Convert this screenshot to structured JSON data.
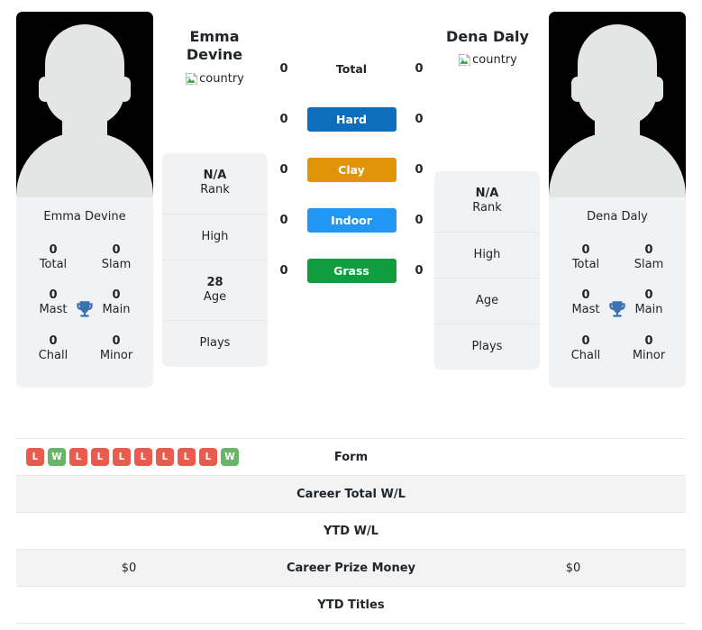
{
  "players": {
    "left": {
      "name": "Emma Devine",
      "photo_caption": "Emma Devine",
      "country_alt": "country",
      "stats": [
        {
          "value": "0",
          "label": "Total"
        },
        {
          "value": "0",
          "label": "Slam"
        },
        {
          "value": "0",
          "label": "Mast"
        },
        {
          "value": "0",
          "label": "Main"
        },
        {
          "value": "0",
          "label": "Chall"
        },
        {
          "value": "0",
          "label": "Minor"
        }
      ],
      "info": [
        {
          "value": "N/A",
          "label": "Rank"
        },
        {
          "value": "",
          "label": "High"
        },
        {
          "value": "28",
          "label": "Age"
        },
        {
          "value": "",
          "label": "Plays"
        }
      ]
    },
    "right": {
      "name": "Dena Daly",
      "photo_caption": "Dena Daly",
      "country_alt": "country",
      "stats": [
        {
          "value": "0",
          "label": "Total"
        },
        {
          "value": "0",
          "label": "Slam"
        },
        {
          "value": "0",
          "label": "Mast"
        },
        {
          "value": "0",
          "label": "Main"
        },
        {
          "value": "0",
          "label": "Chall"
        },
        {
          "value": "0",
          "label": "Minor"
        }
      ],
      "info": [
        {
          "value": "N/A",
          "label": "Rank"
        },
        {
          "value": "",
          "label": "High"
        },
        {
          "value": "",
          "label": "Age"
        },
        {
          "value": "",
          "label": "Plays"
        }
      ]
    }
  },
  "surfaces": [
    {
      "label": "Total",
      "left": "0",
      "right": "0",
      "color": "transparent",
      "plain": true
    },
    {
      "label": "Hard",
      "left": "0",
      "right": "0",
      "color": "#0d6ebd",
      "plain": false
    },
    {
      "label": "Clay",
      "left": "0",
      "right": "0",
      "color": "#e19407",
      "plain": false
    },
    {
      "label": "Indoor",
      "left": "0",
      "right": "0",
      "color": "#2196f3",
      "plain": false
    },
    {
      "label": "Grass",
      "left": "0",
      "right": "0",
      "color": "#0f9d3f",
      "plain": false
    }
  ],
  "table": [
    {
      "label": "Form",
      "type": "form",
      "striped": false,
      "left_form": [
        "L",
        "W",
        "L",
        "L",
        "L",
        "L",
        "L",
        "L",
        "L",
        "W"
      ],
      "right_form": [],
      "left": "",
      "right": ""
    },
    {
      "label": "Career Total W/L",
      "type": "text",
      "striped": true,
      "left": "",
      "right": ""
    },
    {
      "label": "YTD W/L",
      "type": "text",
      "striped": false,
      "left": "",
      "right": ""
    },
    {
      "label": "Career Prize Money",
      "type": "text",
      "striped": true,
      "left": "$0",
      "right": "$0"
    },
    {
      "label": "YTD Titles",
      "type": "text",
      "striped": false,
      "left": "",
      "right": ""
    }
  ],
  "colors": {
    "win_badge": "#68b568",
    "loss_badge": "#ea5b4d",
    "trophy": "#3b72b5",
    "panel_bg": "#f1f2f3",
    "stripe_bg": "#f3f3f4",
    "photo_bg": "#000000"
  },
  "icons": {
    "trophy": "trophy-icon",
    "broken_image": "broken-image-icon"
  }
}
